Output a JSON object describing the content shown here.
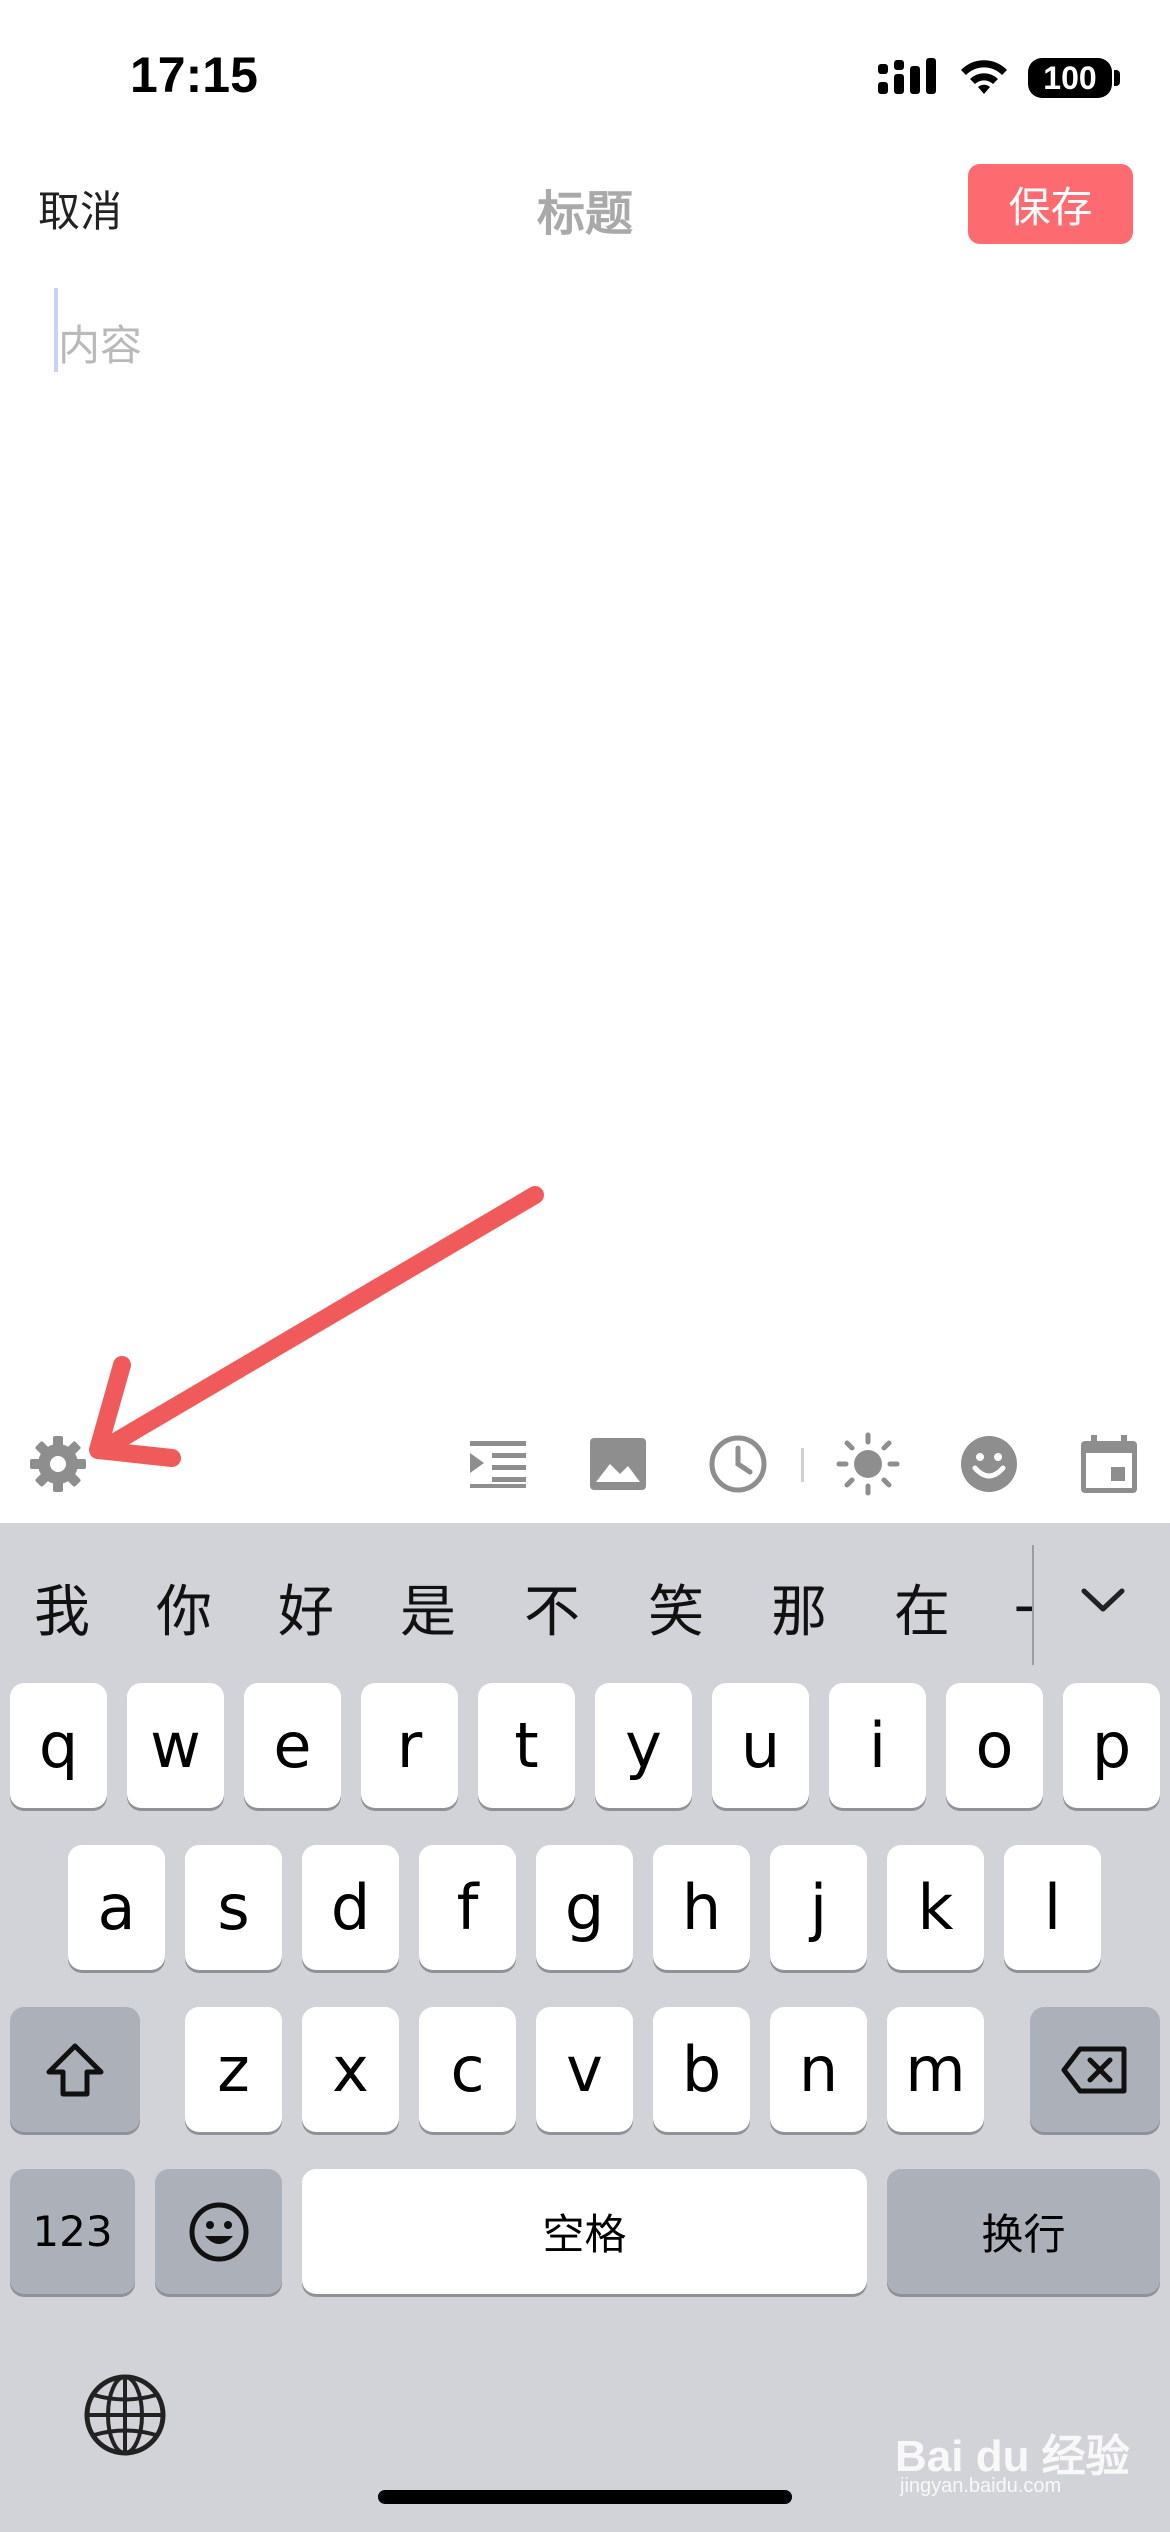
{
  "status_bar": {
    "time": "17:15",
    "battery": "100"
  },
  "nav": {
    "cancel": "取消",
    "title": "标题",
    "save": "保存"
  },
  "content": {
    "placeholder": "内容"
  },
  "toolbar": {
    "items": [
      "gear-icon",
      "indent-icon",
      "image-icon",
      "clock-icon",
      "sun-icon",
      "emoji-icon",
      "calendar-icon"
    ]
  },
  "keyboard": {
    "candidates": [
      "我",
      "你",
      "好",
      "是",
      "不",
      "笑",
      "那",
      "在",
      "一"
    ],
    "row1": [
      "q",
      "w",
      "e",
      "r",
      "t",
      "y",
      "u",
      "i",
      "o",
      "p"
    ],
    "row2": [
      "a",
      "s",
      "d",
      "f",
      "g",
      "h",
      "j",
      "k",
      "l"
    ],
    "row3": [
      "z",
      "x",
      "c",
      "v",
      "b",
      "n",
      "m"
    ],
    "numbers_label": "123",
    "space_label": "空格",
    "return_label": "换行"
  },
  "watermark": {
    "brand": "Bai du 经验",
    "url": "jingyan.baidu.com"
  },
  "colors": {
    "accent": "#fd6a6f",
    "annotation": "#f05a5a",
    "keyboard_bg": "#d1d3d9"
  }
}
